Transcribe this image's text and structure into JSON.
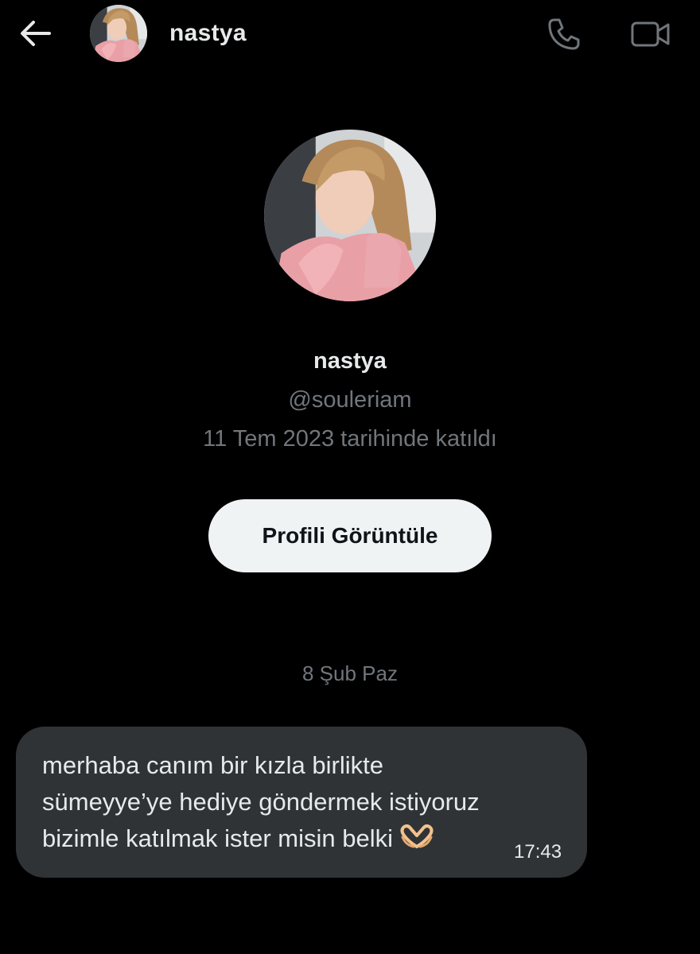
{
  "header": {
    "back_icon": "arrow-left-icon",
    "name": "nastya",
    "call_icon": "phone-icon",
    "video_icon": "video-camera-icon"
  },
  "profile": {
    "name": "nastya",
    "handle": "@souleriam",
    "joined": "11 Tem 2023 tarihinde katıldı",
    "view_button": "Profili Görüntüle"
  },
  "conversation": {
    "date_separator": "8 Şub Paz",
    "messages": [
      {
        "lines": [
          "merhaba canım bir kızla birlikte",
          "sümeyye’ye hediye göndermek istiyoruz",
          "bizimle katılmak ister misin belki"
        ],
        "emoji": "heart-hands-emoji",
        "time": "17:43"
      }
    ]
  },
  "colors": {
    "background": "#000000",
    "primary_text": "#e7e9ea",
    "secondary_text": "#71767b",
    "bubble": "#2f3336",
    "button_bg": "#eff3f4",
    "button_text": "#0f1419"
  }
}
